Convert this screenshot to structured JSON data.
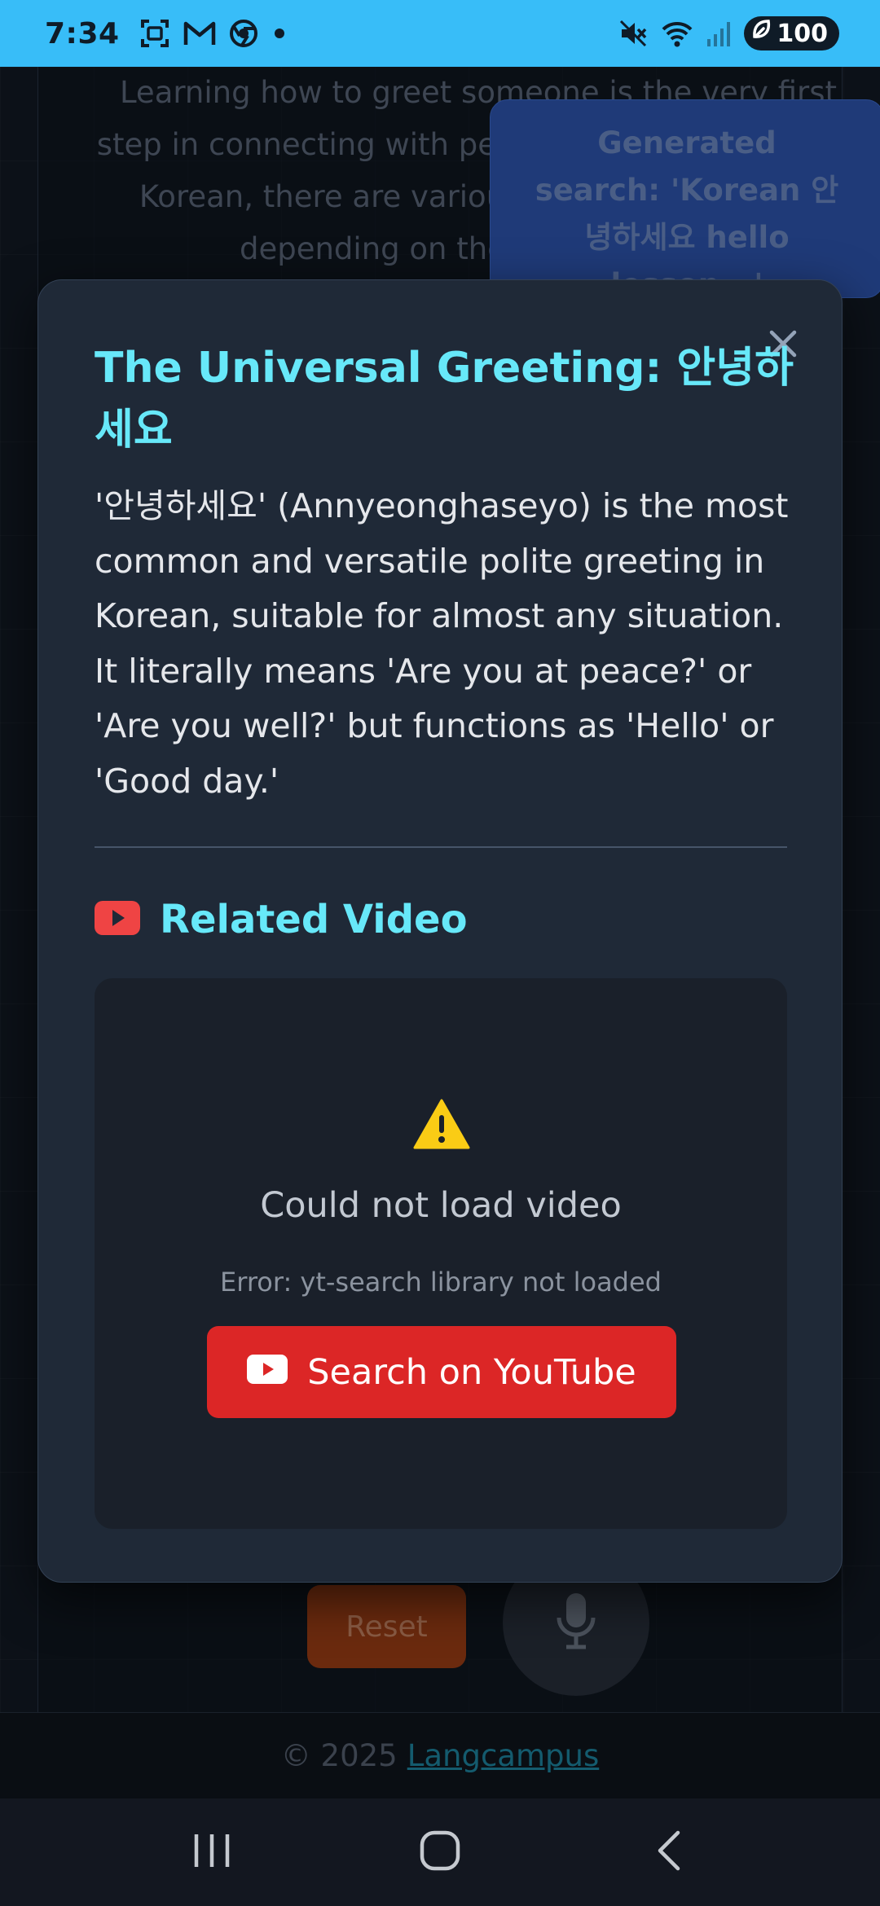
{
  "status_bar": {
    "time": "7:34",
    "battery_level": "100",
    "icons": [
      "screenshot-icon",
      "gmail-icon",
      "chrome-icon",
      "notification-dot-icon",
      "vibrate-mute-icon",
      "wifi-icon",
      "signal-icon",
      "battery-icon"
    ]
  },
  "background": {
    "lesson_text": "Learning how to greet someone is the very first step in connecting with people in any language. In Korean, there are various ways to say 'hello,' depending on the formality and",
    "search_tooltip": "Generated search: 'Korean 안녕하세요 hello lesson...'",
    "reset_label": "Reset",
    "footer_copyright": "© 2025",
    "footer_link": "Langcampus"
  },
  "modal": {
    "title": "The Universal Greeting: 안녕하세요",
    "description": "'안녕하세요' (Annyeonghaseyo) is the most common and versatile polite greeting in Korean, suitable for almost any situation. It literally means 'Are you at peace?' or 'Are you well?' but functions as 'Hello' or 'Good day.'",
    "section_title": "Related Video",
    "video_error_title": "Could not load video",
    "video_error_detail": "Error: yt-search library not loaded",
    "youtube_button_label": "Search on YouTube"
  },
  "colors": {
    "status_bar": "#38bdf8",
    "accent_cyan": "#67e8f9",
    "modal_bg": "#1f2937",
    "youtube_red": "#dc2626",
    "warning_yellow": "#facc15"
  }
}
